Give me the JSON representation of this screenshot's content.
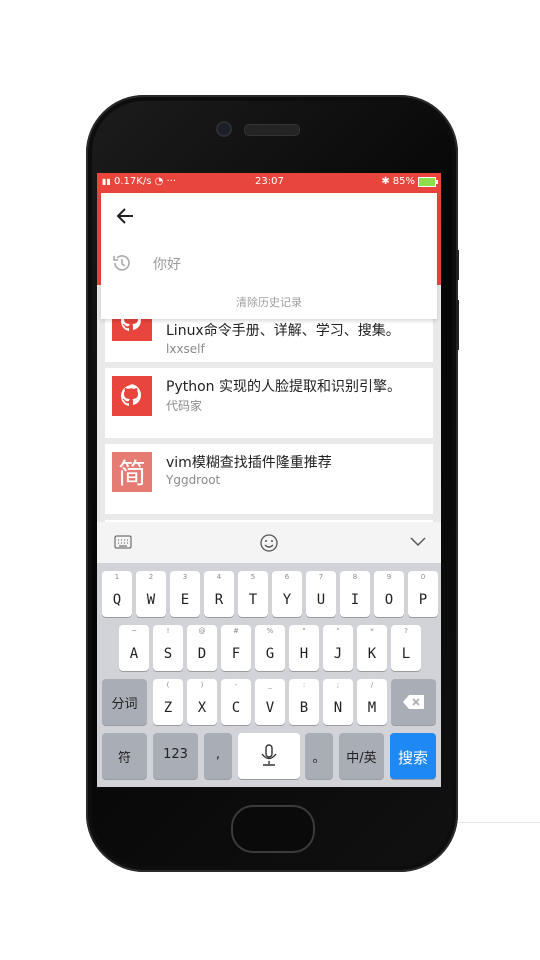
{
  "status": {
    "left": "0.17K/s",
    "time": "23:07",
    "battery": "85%"
  },
  "search": {
    "history_item": "你好",
    "clear_history": "清除历史记录"
  },
  "results": [
    {
      "title": "Linux命令手册、详解、学习、搜集。",
      "author": "lxxself"
    },
    {
      "title": "Python 实现的人脸提取和识别引擎。",
      "author": "代码家"
    },
    {
      "title": "vim模糊查找插件隆重推荐",
      "author": "Yggdroot",
      "logo_char": "简"
    }
  ],
  "keyboard": {
    "row1": [
      {
        "sup": "1",
        "key": "Q"
      },
      {
        "sup": "2",
        "key": "W"
      },
      {
        "sup": "3",
        "key": "E"
      },
      {
        "sup": "4",
        "key": "R"
      },
      {
        "sup": "5",
        "key": "T"
      },
      {
        "sup": "6",
        "key": "Y"
      },
      {
        "sup": "7",
        "key": "U"
      },
      {
        "sup": "8",
        "key": "I"
      },
      {
        "sup": "9",
        "key": "O"
      },
      {
        "sup": "0",
        "key": "P"
      }
    ],
    "row2": [
      {
        "sup": "~",
        "key": "A"
      },
      {
        "sup": "!",
        "key": "S"
      },
      {
        "sup": "@",
        "key": "D"
      },
      {
        "sup": "#",
        "key": "F"
      },
      {
        "sup": "%",
        "key": "G"
      },
      {
        "sup": "\"",
        "key": "H"
      },
      {
        "sup": "\"",
        "key": "J"
      },
      {
        "sup": "*",
        "key": "K"
      },
      {
        "sup": "?",
        "key": "L"
      }
    ],
    "row3": [
      {
        "sup": "(",
        "key": "Z"
      },
      {
        "sup": ")",
        "key": "X"
      },
      {
        "sup": "-",
        "key": "C"
      },
      {
        "sup": "_",
        "key": "V"
      },
      {
        "sup": ":",
        "key": "B"
      },
      {
        "sup": ";",
        "key": "N"
      },
      {
        "sup": "/",
        "key": "M"
      }
    ],
    "fenci": "分词",
    "symbols": "符",
    "numbers": "123",
    "comma": ",",
    "period": "。",
    "lang": "中/英",
    "search": "搜索"
  }
}
